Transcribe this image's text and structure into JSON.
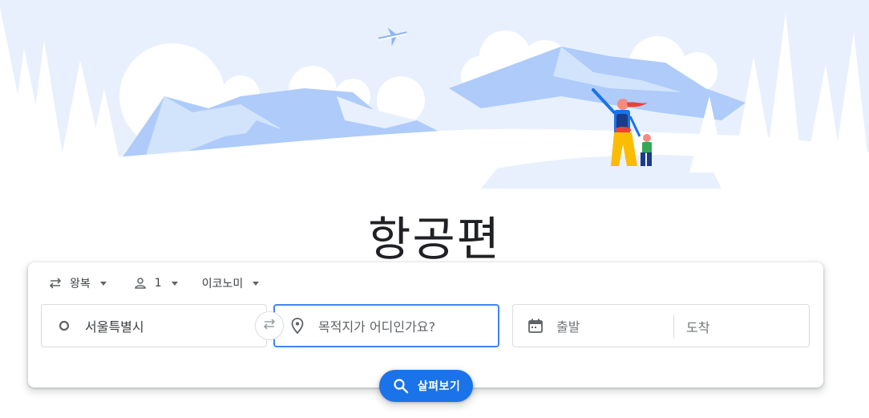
{
  "page": {
    "title": "항공편"
  },
  "options": {
    "trip_type": "왕복",
    "passengers": "1",
    "cabin_class": "이코노미"
  },
  "fields": {
    "origin_value": "서울특별시",
    "destination_placeholder": "목적지가 어디인가요?",
    "departure_placeholder": "출발",
    "return_placeholder": "도착"
  },
  "actions": {
    "search_label": "살펴보기"
  },
  "colors": {
    "accent": "#1a73e8",
    "focus_border": "#4285f4",
    "hero_sky": "#e8f0fe",
    "hero_mountain": "#aecbfa"
  },
  "icons": {
    "trip_type": "swap-horiz-icon",
    "passengers": "person-outline-icon",
    "origin": "circle-outline-icon",
    "swap": "swap-arrows-icon",
    "destination": "location-pin-icon",
    "dates": "calendar-icon",
    "search": "search-icon"
  }
}
